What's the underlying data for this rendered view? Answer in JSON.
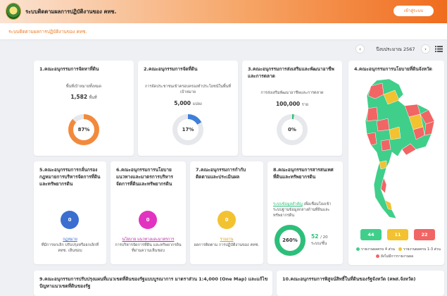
{
  "header": {
    "app_title": "ระบบติดตามผลการปฏิบัติงานของ คทช.",
    "login_label": "เข้าสู่ระบบ"
  },
  "subbar": {
    "title": "ระบบติดตามผลการปฏิบัติงานของ คทช."
  },
  "year_nav": {
    "label": "ปีงบประมาณ 2567",
    "prev": "‹",
    "next": "›"
  },
  "cards": {
    "c1": {
      "title": "1.คณะอนุกรรมการจัดหาที่ดิน",
      "desc": "พื้นที่เป้าหมายทั้งหมด",
      "value": "1,582",
      "unit": "พื้นที่",
      "percent_label": "87%",
      "percent": 87,
      "color": "#f28a3c"
    },
    "c2": {
      "title": "2.คณะอนุกรรมการจัดที่ดิน",
      "desc": "การจัดประชาชนเข้าครอบครองทำประโยชน์ในพื้นที่เป้าหมาย",
      "value": "5,000",
      "unit": "แปลง",
      "percent_label": "17%",
      "percent": 17,
      "color": "#3f7fd9"
    },
    "c3": {
      "title": "3.คณะอนุกรรมการส่งเสริมและพัฒนาอาชีพและการตลาด",
      "desc": "การส่งเสริมพัฒนาอาชีพและการตลาด",
      "value": "100,000",
      "unit": "ราย",
      "percent_label": "0%",
      "percent": 2,
      "color": "#2dbf7a"
    },
    "c5": {
      "title": "5.คณะอนุกรรมการกลั่นกรองกฎหมายการบริหารจัดการที่ดินและทรัพยากรดิน",
      "bubble": "0",
      "link": "กฎหมาย",
      "desc": "ที่มีการยกเลิก ปรับปรุงหรือยกเลิกที่ คทช. เห็นชอบ",
      "color": "#3a6ed0"
    },
    "c6": {
      "title": "6.คณะอนุกรรมการนโยบายแนวทางและมาตรการบริหารจัดการที่ดินและทรัพยากรดิน",
      "bubble": "0",
      "link": "นโยบาย แนวทางและมาตรการ",
      "desc": "การบริหารจัดการที่ดิน และทรัพยากรดินที่ผ่านความเห็นชอบ",
      "color": "#e233c0"
    },
    "c7": {
      "title": "7.คณะอนุกรรมการกำกับ ติดตามและประเมินผล",
      "bubble": "0",
      "link": "รายงาน",
      "desc": "ผลการติดตาม การปฏิบัติงานของ คทช.",
      "color": "#f2c230"
    },
    "c8": {
      "title": "8.คณะอนุกรรมการสารสนเทศที่ดินและทรัพยากรดิน",
      "link": "ระบบข้อมูลสำคัญ",
      "desc": "เพื่อเชื่อมโยงเข้าระบบฐานข้อมูลกลางด้านที่ดินและทรัพยากรดิน",
      "percent_label": "260%",
      "percent": 100,
      "count": "52",
      "total": "/ 20",
      "count_unit": "ระบบ/ชั้น",
      "color": "#2dbf7a"
    },
    "c4": {
      "title": "4.คณะอนุกรรมการนโยบายที่ดินจังหวัด"
    },
    "c9": {
      "title": "9.คณะอนุกรรมการปรับปรุงแผนที่แนวเขตที่ดินของรัฐแบบบูรณาการ มาตราส่วน 1:4,000 (One Map) และแก้ไขปัญหาแนวเขตที่ดินของรัฐ"
    },
    "c10": {
      "title": "10.คณะอนุกรรมการพิสูจน์สิทธิ์ในที่ดินของรัฐจังหวัด (คพส.จังหวัด)"
    }
  },
  "map_stats": [
    {
      "value": "44",
      "color": "#3fcf8a"
    },
    {
      "value": "11",
      "color": "#f2c230"
    },
    {
      "value": "22",
      "color": "#f16565"
    }
  ],
  "map_legend": [
    {
      "label": "รายงานผลครบ 4 ส่วน",
      "color": "#3fcf8a"
    },
    {
      "label": "รายงานผลครบ 1-3 ส่วน",
      "color": "#f2c230"
    },
    {
      "label": "ยังไม่มีการรายงานผล",
      "color": "#f16565"
    }
  ],
  "colors": {
    "accent": "#ef7a22",
    "header_end": "#f06c1e"
  }
}
